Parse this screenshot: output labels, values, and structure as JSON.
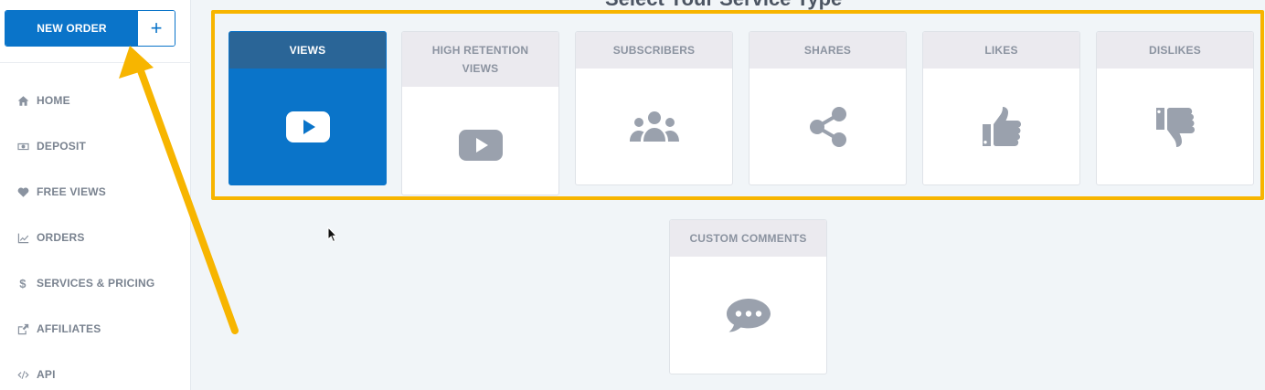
{
  "page": {
    "heading": "Select Your Service Type"
  },
  "sidebar": {
    "new_order_label": "NEW ORDER",
    "new_order_plus": "+",
    "items": [
      {
        "label": "HOME",
        "icon": "home-icon"
      },
      {
        "label": "DEPOSIT",
        "icon": "money-icon"
      },
      {
        "label": "FREE VIEWS",
        "icon": "heart-icon"
      },
      {
        "label": "ORDERS",
        "icon": "chart-icon"
      },
      {
        "label": "SERVICES & PRICING",
        "icon": "dollar-icon",
        "glyph": "$"
      },
      {
        "label": "AFFILIATES",
        "icon": "share-square-icon"
      },
      {
        "label": "API",
        "icon": "code-icon"
      }
    ]
  },
  "services": [
    {
      "label": "VIEWS",
      "icon": "play-icon",
      "active": true
    },
    {
      "label": "HIGH RETENTION VIEWS",
      "line1": "HIGH RETENTION",
      "line2": "VIEWS",
      "icon": "play-icon",
      "active": false
    },
    {
      "label": "SUBSCRIBERS",
      "icon": "users-icon",
      "active": false
    },
    {
      "label": "SHARES",
      "icon": "share-icon",
      "active": false
    },
    {
      "label": "LIKES",
      "icon": "thumbs-up-icon",
      "active": false
    },
    {
      "label": "DISLIKES",
      "icon": "thumbs-down-icon",
      "active": false
    },
    {
      "label": "CUSTOM COMMENTS",
      "icon": "comments-icon",
      "active": false
    }
  ],
  "colors": {
    "primary": "#0a74c9",
    "active_header": "#2a6597",
    "highlight": "#f7b500",
    "card_header": "#ebeaef",
    "icon_gray": "#9aa1ad",
    "background": "#f1f5f8"
  }
}
